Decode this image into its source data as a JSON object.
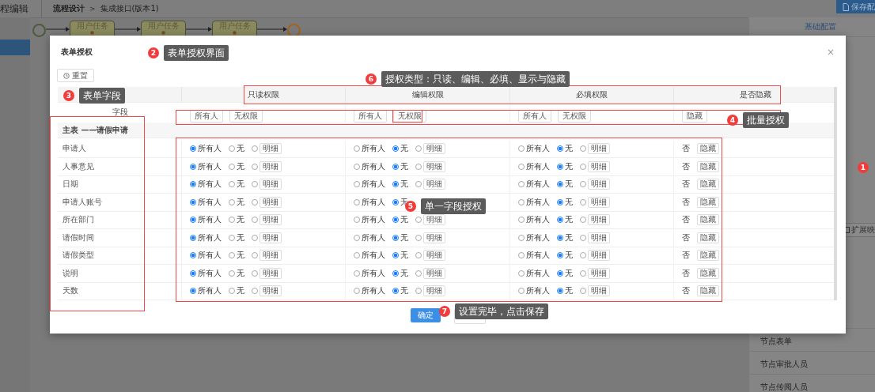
{
  "top_bar": {
    "app_title": "程编辑",
    "breadcrumb": [
      "流程设计",
      "集成接口(版本1)"
    ],
    "separator": ">",
    "save_button": "保存配"
  },
  "flow": {
    "tasks": [
      "用户任务",
      "用户任务",
      "用户任务"
    ]
  },
  "side_panel": {
    "tab": "基础配置",
    "extend_button": "扩展映",
    "items": [
      "节点表单",
      "节点审批人员",
      "节点传阅人员"
    ]
  },
  "dialog": {
    "title": "表单授权",
    "close": "×",
    "reset_button": "重置",
    "columns": [
      "只读权限",
      "编辑权限",
      "必填权限",
      "是否隐藏"
    ],
    "field_column": "字段",
    "batch": [
      {
        "buttons": [
          "所有人",
          "无权限"
        ]
      },
      {
        "buttons": [
          "所有人",
          "无权限"
        ]
      },
      {
        "buttons": [
          "所有人",
          "无权限"
        ]
      }
    ],
    "batch_hide_button": "隐藏",
    "group": "主表 ——请假申请",
    "rows": [
      {
        "field": "申请人",
        "perms": [
          {
            "options": [
              {
                "kind": "radio",
                "label": "所有人",
                "selected": true
              },
              {
                "kind": "radio",
                "label": "无",
                "selected": false
              },
              {
                "kind": "detail",
                "label": "明细",
                "selected": false
              }
            ]
          },
          {
            "options": [
              {
                "kind": "radio",
                "label": "所有人",
                "selected": false
              },
              {
                "kind": "radio",
                "label": "无",
                "selected": true
              },
              {
                "kind": "detail",
                "label": "明细",
                "selected": false
              }
            ]
          },
          {
            "options": [
              {
                "kind": "radio",
                "label": "所有人",
                "selected": false
              },
              {
                "kind": "radio",
                "label": "无",
                "selected": true
              },
              {
                "kind": "detail",
                "label": "明细",
                "selected": false
              }
            ]
          }
        ],
        "hidden_value": "否",
        "hide_button": "隐藏"
      },
      {
        "field": "人事意见",
        "perms": [
          {
            "options": [
              {
                "kind": "radio",
                "label": "所有人",
                "selected": true
              },
              {
                "kind": "radio",
                "label": "无",
                "selected": false
              },
              {
                "kind": "detail",
                "label": "明细",
                "selected": false
              }
            ]
          },
          {
            "options": [
              {
                "kind": "radio",
                "label": "所有人",
                "selected": false
              },
              {
                "kind": "radio",
                "label": "无",
                "selected": true
              },
              {
                "kind": "detail",
                "label": "明细",
                "selected": false
              }
            ]
          },
          {
            "options": [
              {
                "kind": "radio",
                "label": "所有人",
                "selected": false
              },
              {
                "kind": "radio",
                "label": "无",
                "selected": true
              },
              {
                "kind": "detail",
                "label": "明细",
                "selected": false
              }
            ]
          }
        ],
        "hidden_value": "否",
        "hide_button": "隐藏"
      },
      {
        "field": "日期",
        "perms": [
          {
            "options": [
              {
                "kind": "radio",
                "label": "所有人",
                "selected": true
              },
              {
                "kind": "radio",
                "label": "无",
                "selected": false
              },
              {
                "kind": "detail",
                "label": "明细",
                "selected": false
              }
            ]
          },
          {
            "options": [
              {
                "kind": "radio",
                "label": "所有人",
                "selected": false
              },
              {
                "kind": "radio",
                "label": "无",
                "selected": true
              },
              {
                "kind": "detail",
                "label": "明细",
                "selected": false
              }
            ]
          },
          {
            "options": [
              {
                "kind": "radio",
                "label": "所有人",
                "selected": false
              },
              {
                "kind": "radio",
                "label": "无",
                "selected": true
              },
              {
                "kind": "detail",
                "label": "明细",
                "selected": false
              }
            ]
          }
        ],
        "hidden_value": "否",
        "hide_button": "隐藏"
      },
      {
        "field": "申请人账号",
        "perms": [
          {
            "options": [
              {
                "kind": "radio",
                "label": "所有人",
                "selected": true
              },
              {
                "kind": "radio",
                "label": "无",
                "selected": false
              },
              {
                "kind": "detail",
                "label": "明细",
                "selected": false
              }
            ]
          },
          {
            "options": [
              {
                "kind": "radio",
                "label": "所有人",
                "selected": false
              },
              {
                "kind": "radio",
                "label": "无",
                "selected": true
              }
            ]
          },
          {
            "options": [
              {
                "kind": "radio",
                "label": "所有人",
                "selected": false
              },
              {
                "kind": "radio",
                "label": "无",
                "selected": true
              },
              {
                "kind": "detail",
                "label": "明细",
                "selected": false
              }
            ]
          }
        ],
        "hidden_value": "否",
        "hide_button": "隐藏"
      },
      {
        "field": "所在部门",
        "perms": [
          {
            "options": [
              {
                "kind": "radio",
                "label": "所有人",
                "selected": true
              },
              {
                "kind": "radio",
                "label": "无",
                "selected": false
              },
              {
                "kind": "detail",
                "label": "明细",
                "selected": false
              }
            ]
          },
          {
            "options": [
              {
                "kind": "radio",
                "label": "所有人",
                "selected": false
              },
              {
                "kind": "radio",
                "label": "无",
                "selected": true
              },
              {
                "kind": "detail",
                "label": "明细",
                "selected": false
              }
            ]
          },
          {
            "options": [
              {
                "kind": "radio",
                "label": "所有人",
                "selected": false
              },
              {
                "kind": "radio",
                "label": "无",
                "selected": true
              },
              {
                "kind": "detail",
                "label": "明细",
                "selected": false
              }
            ]
          }
        ],
        "hidden_value": "否",
        "hide_button": "隐藏"
      },
      {
        "field": "请假时间",
        "perms": [
          {
            "options": [
              {
                "kind": "radio",
                "label": "所有人",
                "selected": true
              },
              {
                "kind": "radio",
                "label": "无",
                "selected": false
              },
              {
                "kind": "detail",
                "label": "明细",
                "selected": false
              }
            ]
          },
          {
            "options": [
              {
                "kind": "radio",
                "label": "所有人",
                "selected": false
              },
              {
                "kind": "radio",
                "label": "无",
                "selected": true
              },
              {
                "kind": "detail",
                "label": "明细",
                "selected": false
              }
            ]
          },
          {
            "options": [
              {
                "kind": "radio",
                "label": "所有人",
                "selected": false
              },
              {
                "kind": "radio",
                "label": "无",
                "selected": true
              },
              {
                "kind": "detail",
                "label": "明细",
                "selected": false
              }
            ]
          }
        ],
        "hidden_value": "否",
        "hide_button": "隐藏"
      },
      {
        "field": "请假类型",
        "perms": [
          {
            "options": [
              {
                "kind": "radio",
                "label": "所有人",
                "selected": true
              },
              {
                "kind": "radio",
                "label": "无",
                "selected": false
              },
              {
                "kind": "detail",
                "label": "明细",
                "selected": false
              }
            ]
          },
          {
            "options": [
              {
                "kind": "radio",
                "label": "所有人",
                "selected": false
              },
              {
                "kind": "radio",
                "label": "无",
                "selected": true
              },
              {
                "kind": "detail",
                "label": "明细",
                "selected": false
              }
            ]
          },
          {
            "options": [
              {
                "kind": "radio",
                "label": "所有人",
                "selected": false
              },
              {
                "kind": "radio",
                "label": "无",
                "selected": true
              },
              {
                "kind": "detail",
                "label": "明细",
                "selected": false
              }
            ]
          }
        ],
        "hidden_value": "否",
        "hide_button": "隐藏"
      },
      {
        "field": "说明",
        "perms": [
          {
            "options": [
              {
                "kind": "radio",
                "label": "所有人",
                "selected": true
              },
              {
                "kind": "radio",
                "label": "无",
                "selected": false
              },
              {
                "kind": "detail",
                "label": "明细",
                "selected": false
              }
            ]
          },
          {
            "options": [
              {
                "kind": "radio",
                "label": "所有人",
                "selected": false
              },
              {
                "kind": "radio",
                "label": "无",
                "selected": true
              },
              {
                "kind": "detail",
                "label": "明细",
                "selected": false
              }
            ]
          },
          {
            "options": [
              {
                "kind": "radio",
                "label": "所有人",
                "selected": false
              },
              {
                "kind": "radio",
                "label": "无",
                "selected": true
              },
              {
                "kind": "detail",
                "label": "明细",
                "selected": false
              }
            ]
          }
        ],
        "hidden_value": "否",
        "hide_button": "隐藏"
      },
      {
        "field": "天数",
        "perms": [
          {
            "options": [
              {
                "kind": "radio",
                "label": "所有人",
                "selected": true
              },
              {
                "kind": "radio",
                "label": "无",
                "selected": false
              },
              {
                "kind": "detail",
                "label": "明细",
                "selected": false
              }
            ]
          },
          {
            "options": [
              {
                "kind": "radio",
                "label": "所有人",
                "selected": false
              },
              {
                "kind": "radio",
                "label": "无",
                "selected": true
              },
              {
                "kind": "detail",
                "label": "明细",
                "selected": false
              }
            ]
          },
          {
            "options": [
              {
                "kind": "radio",
                "label": "所有人",
                "selected": false
              },
              {
                "kind": "radio",
                "label": "无",
                "selected": true
              },
              {
                "kind": "detail",
                "label": "明细",
                "selected": false
              }
            ]
          }
        ],
        "hidden_value": "否",
        "hide_button": "隐藏"
      }
    ],
    "confirm_button": "确定"
  },
  "annotations": [
    {
      "number": "1"
    },
    {
      "number": "2",
      "label": "表单授权界面"
    },
    {
      "number": "3",
      "label": "表单字段"
    },
    {
      "number": "4",
      "label": "批量授权"
    },
    {
      "number": "5",
      "label": "单一字段授权"
    },
    {
      "number": "6",
      "label": "授权类型：只读、编辑、必填、显示与隐藏"
    },
    {
      "number": "7",
      "label": "设置完毕，点击保存"
    }
  ]
}
